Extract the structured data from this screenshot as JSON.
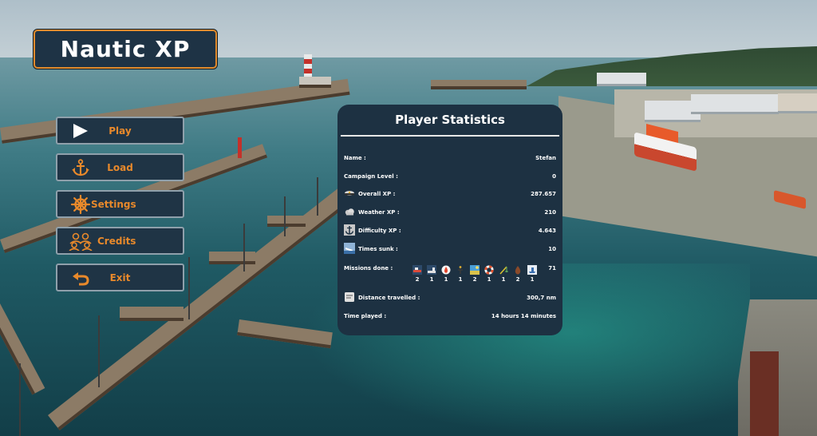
{
  "app": {
    "logo_text": "Nautic XP"
  },
  "menu": {
    "play_label": "Play",
    "load_label": "Load",
    "settings_label": "Settings",
    "credits_label": "Credits",
    "exit_label": "Exit",
    "icons": [
      "play-icon",
      "anchor-icon",
      "ship-wheel-icon",
      "credits-people-icon",
      "back-arrow-icon"
    ]
  },
  "stats": {
    "title": "Player Statistics",
    "name_label": "Name :",
    "name_value": "Stefan",
    "campaign_label": "Campaign Level :",
    "campaign_value": "0",
    "overall_label": "Overall XP :",
    "overall_value": "287.657",
    "weather_label": "Weather XP :",
    "weather_value": "210",
    "difficulty_label": "Difficulty XP :",
    "difficulty_value": "4.643",
    "sunk_label": "Times sunk :",
    "sunk_value": "10",
    "missions_label": "Missions done :",
    "missions_total": "71",
    "mission_counts": [
      "2",
      "1",
      "1",
      "1",
      "2",
      "1",
      "1",
      "2",
      "1"
    ],
    "distance_label": "Distance travelled :",
    "distance_value": "300,7 nm",
    "time_label": "Time played :",
    "time_value": "14 hours 14 minutes"
  },
  "colors": {
    "accent": "#e8892b",
    "panel": "#1d3142",
    "button": "#1f3445",
    "button_border": "#8fa0ab"
  }
}
